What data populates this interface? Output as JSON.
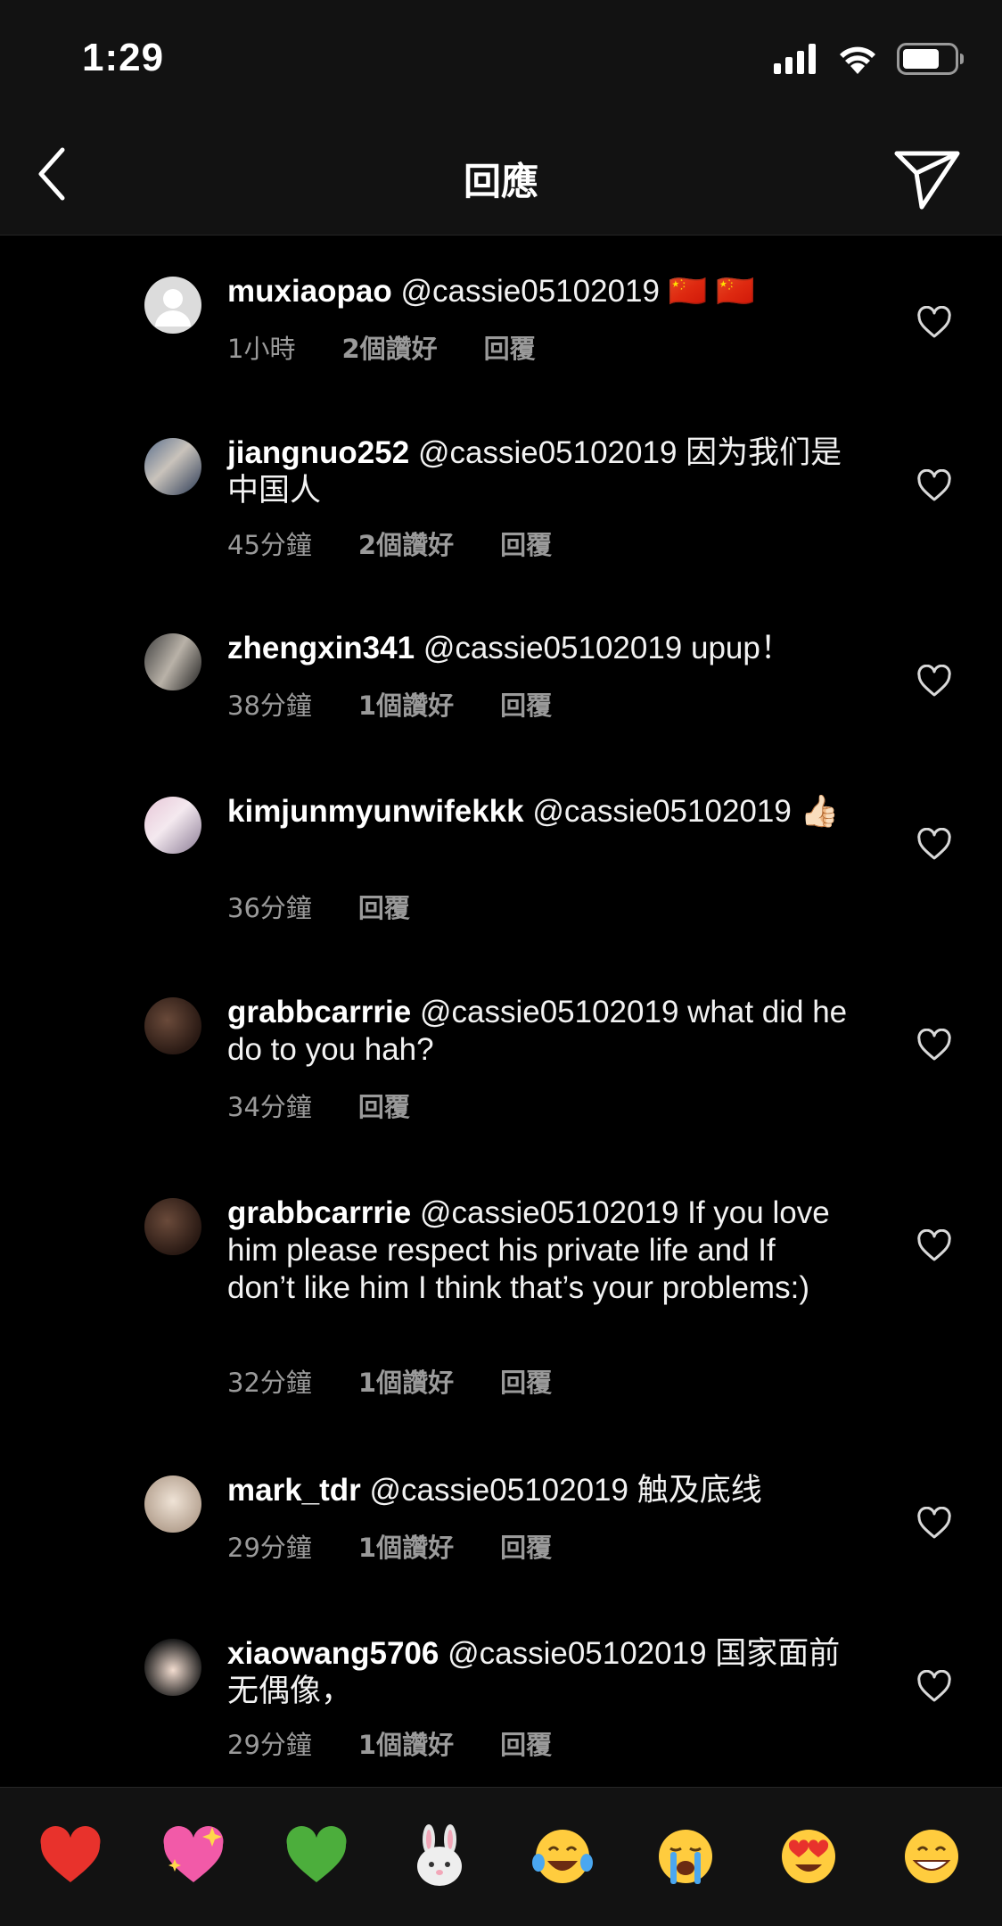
{
  "status_bar": {
    "time": "1:29"
  },
  "header": {
    "title": "回應"
  },
  "comments": [
    {
      "username": "muxiaopao",
      "text": "@cassie05102019 🇨🇳 🇨🇳",
      "time": "1小時",
      "likes": "2個讚好",
      "reply": "回覆"
    },
    {
      "username": "jiangnuo252",
      "text": "@cassie05102019 因为我们是中国人",
      "time": "45分鐘",
      "likes": "2個讚好",
      "reply": "回覆"
    },
    {
      "username": "zhengxin341",
      "text": "@cassie05102019 upup！",
      "time": "38分鐘",
      "likes": "1個讚好",
      "reply": "回覆"
    },
    {
      "username": "kimjunmyunwifekkk",
      "text": "@cassie05102019 👍🏻",
      "time": "36分鐘",
      "reply": "回覆"
    },
    {
      "username": "grabbcarrrie",
      "text": "@cassie05102019 what did he do to you hah?",
      "time": "34分鐘",
      "reply": "回覆"
    },
    {
      "username": "grabbcarrrie",
      "text": "@cassie05102019 If you love him please respect his private life and If don’t like him I think that’s your problems:)",
      "time": "32分鐘",
      "likes": "1個讚好",
      "reply": "回覆"
    },
    {
      "username": "mark_tdr",
      "text": "@cassie05102019 触及底线",
      "time": "29分鐘",
      "likes": "1個讚好",
      "reply": "回覆"
    },
    {
      "username": "xiaowang5706",
      "text": "@cassie05102019 国家面前无偶像，",
      "time": "29分鐘",
      "likes": "1個讚好",
      "reply": "回覆"
    }
  ],
  "emoji_bar": [
    "red-heart",
    "sparkling-heart",
    "green-heart",
    "rabbit-face",
    "tears-of-joy",
    "loudly-crying",
    "heart-eyes",
    "beaming-grin"
  ],
  "colors": {
    "background": "#000000",
    "bar": "#121212",
    "meta_text": "#9a9a9a"
  }
}
